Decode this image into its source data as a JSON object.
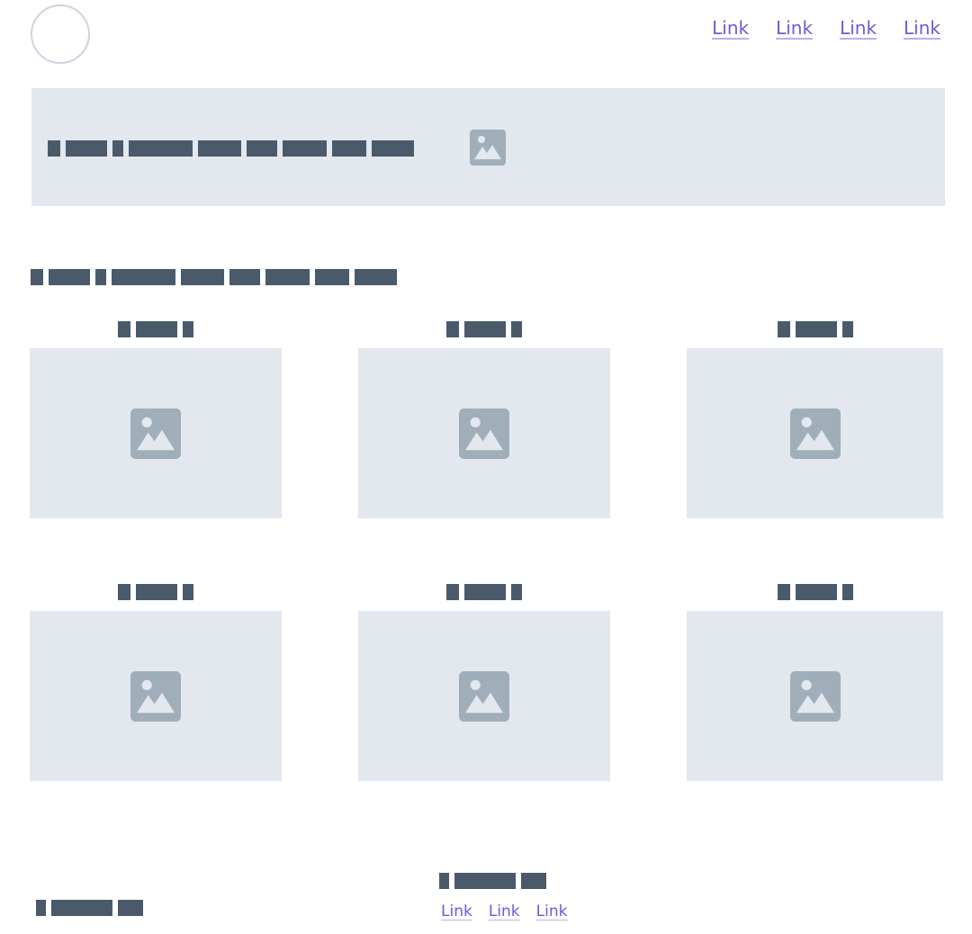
{
  "header": {
    "nav_links": [
      "Link",
      "Link",
      "Link",
      "Link"
    ]
  },
  "hero": {
    "image_icon": "image-icon"
  },
  "cards": [
    {
      "image_icon": "image-icon"
    },
    {
      "image_icon": "image-icon"
    },
    {
      "image_icon": "image-icon"
    },
    {
      "image_icon": "image-icon"
    },
    {
      "image_icon": "image-icon"
    },
    {
      "image_icon": "image-icon"
    }
  ],
  "footer": {
    "links": [
      "Link",
      "Link",
      "Link"
    ]
  },
  "colors": {
    "link": "#6b5bdc",
    "placeholder_bg": "#e2e8ed",
    "redacted_text": "#4a5a6a",
    "icon": "#a0aeba"
  }
}
